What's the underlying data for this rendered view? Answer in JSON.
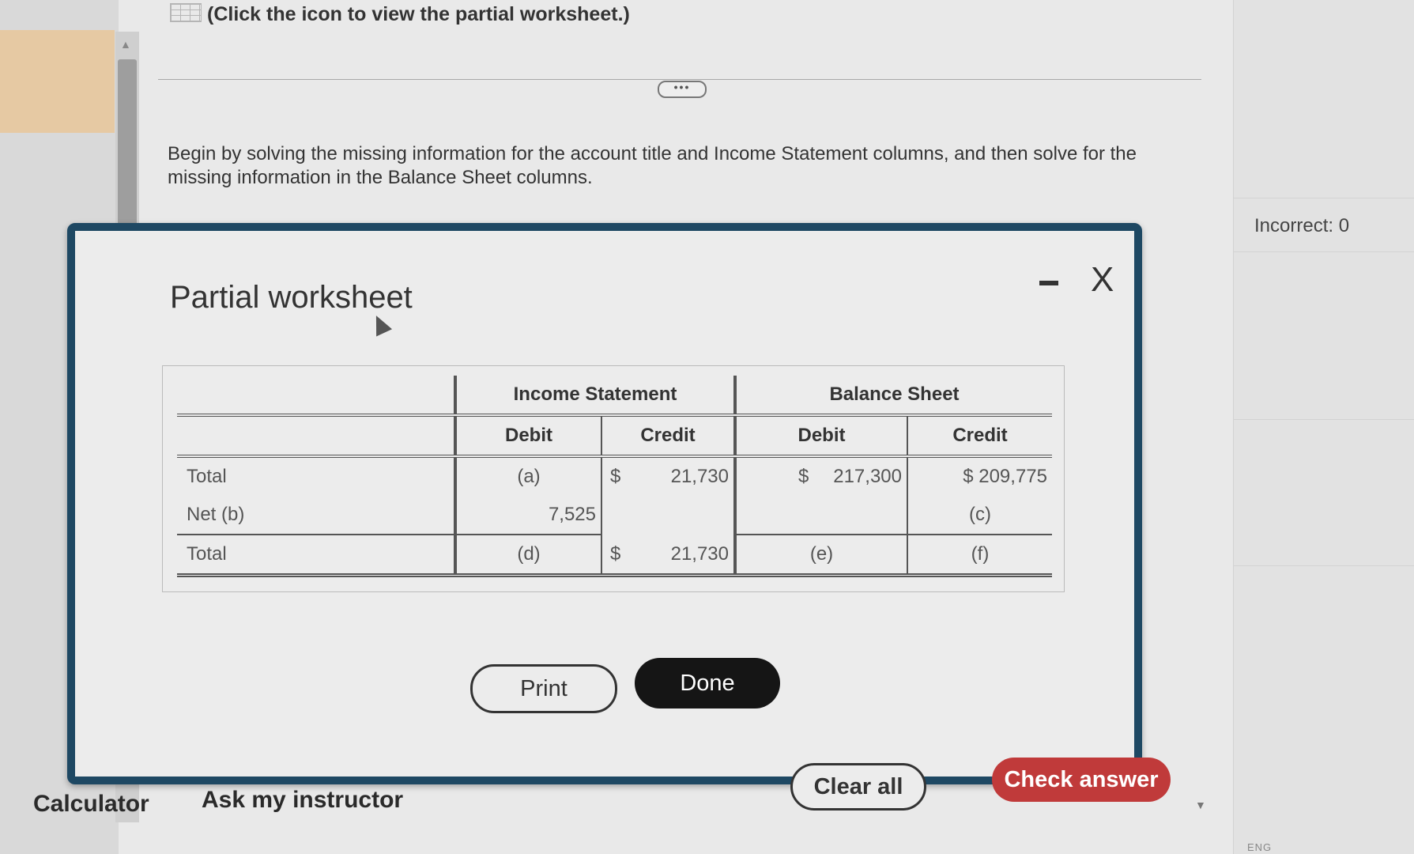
{
  "header": {
    "worksheet_link": "(Click the icon to view the partial worksheet.)",
    "more_button": "•••"
  },
  "instruction": "Begin by solving the missing information for the account title and Income Statement columns, and then solve for the missing information in the Balance Sheet columns.",
  "sidebar": {
    "incorrect": "Incorrect: 0",
    "lang": "ENG"
  },
  "modal": {
    "title": "Partial worksheet",
    "minimize_icon": "minimize-icon",
    "close_icon": "close-icon",
    "close_glyph": "X",
    "table": {
      "group_headers": [
        "Income Statement",
        "Balance Sheet"
      ],
      "sub_headers": [
        "Debit",
        "Credit",
        "Debit",
        "Credit"
      ],
      "rows": [
        {
          "label": "Total",
          "is_debit": "(a)",
          "is_credit_sym": "$",
          "is_credit": "21,730",
          "bs_debit_sym": "$",
          "bs_debit": "217,300",
          "bs_credit": "$  209,775"
        },
        {
          "label": "Net (b)",
          "is_debit": "7,525",
          "is_credit_sym": "",
          "is_credit": "",
          "bs_debit_sym": "",
          "bs_debit": "",
          "bs_credit": "(c)"
        },
        {
          "label": "Total",
          "is_debit": "(d)",
          "is_credit_sym": "$",
          "is_credit": "21,730",
          "bs_debit_sym": "",
          "bs_debit": "(e)",
          "bs_credit": "(f)"
        }
      ]
    },
    "print_label": "Print",
    "done_label": "Done"
  },
  "footer": {
    "calculator": "Calculator",
    "ask_instructor": "Ask my instructor",
    "clear_all": "Clear all",
    "check_answer": "Check answer"
  },
  "colors": {
    "modal_border": "#1e4863",
    "done_bg": "#151515",
    "check_bg": "#c03a3a"
  }
}
